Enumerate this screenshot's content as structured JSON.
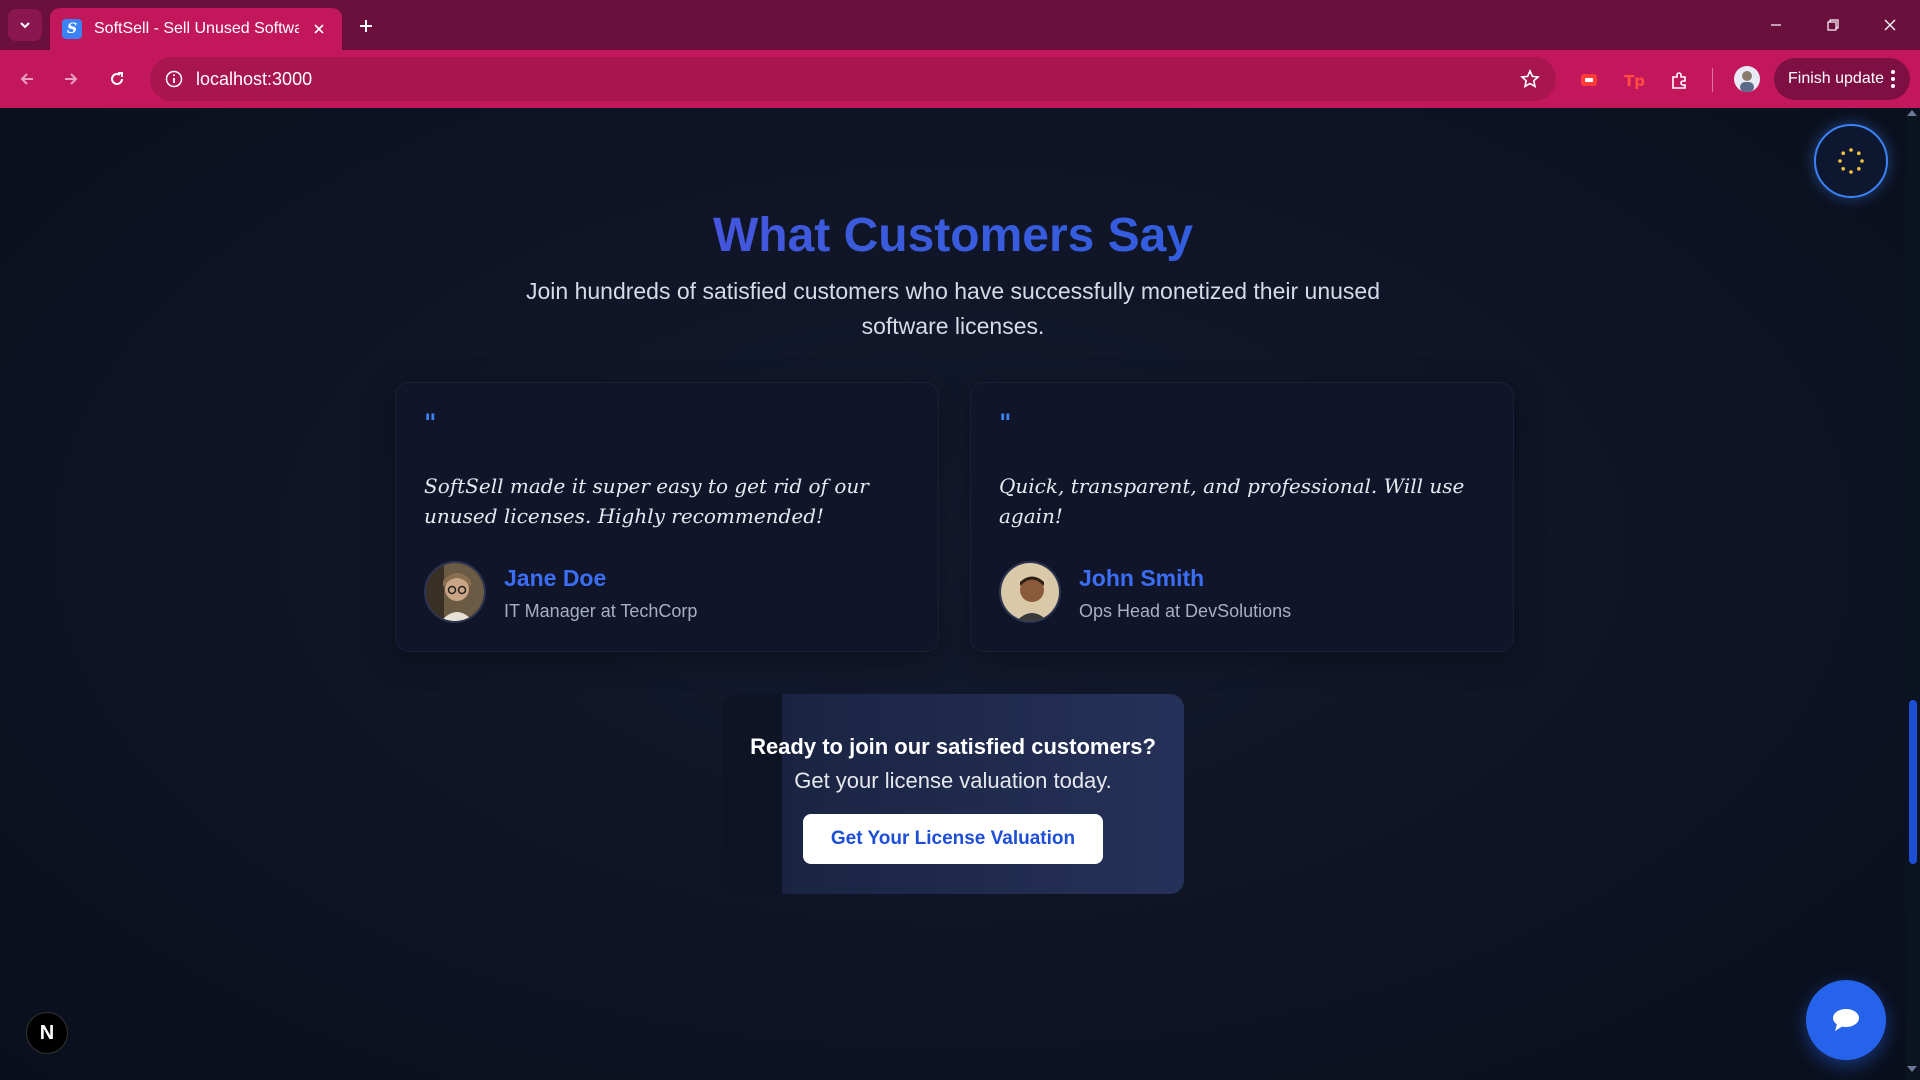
{
  "browser": {
    "tab": {
      "title": "SoftSell - Sell Unused Software",
      "favicon_letter": "S"
    },
    "url": "localhost:3000",
    "finish_update_label": "Finish update",
    "icons": [
      "tab-list-icon",
      "close-icon",
      "plus-icon",
      "minimize-icon",
      "restore-icon",
      "close-window-icon",
      "back-icon",
      "forward-icon",
      "reload-icon",
      "info-icon",
      "star-icon",
      "extension-icon",
      "puzzle-icon",
      "profile-icon",
      "more-icon"
    ]
  },
  "section": {
    "title": "What Customers Say",
    "subtitle": "Join hundreds of satisfied customers who have successfully monetized their unused software licenses."
  },
  "testimonials": [
    {
      "quote_mark": "\"",
      "quote": "SoftSell made it super easy to get rid of our unused licenses. Highly recommended!",
      "name": "Jane Doe",
      "role": "IT Manager at TechCorp"
    },
    {
      "quote_mark": "\"",
      "quote": "Quick, transparent, and professional. Will use again!",
      "name": "John Smith",
      "role": "Ops Head at DevSolutions"
    }
  ],
  "cta": {
    "line1": "Ready to join our satisfied customers?",
    "line2": "Get your license valuation today.",
    "button_label": "Get Your License Valuation"
  },
  "next_badge": "N",
  "colors": {
    "accent": "#2563eb",
    "heading_gradient_start": "#7c3aed",
    "chrome": "#c2185b",
    "tabbar": "#6b0f3d",
    "page_bg": "#0b1220"
  }
}
